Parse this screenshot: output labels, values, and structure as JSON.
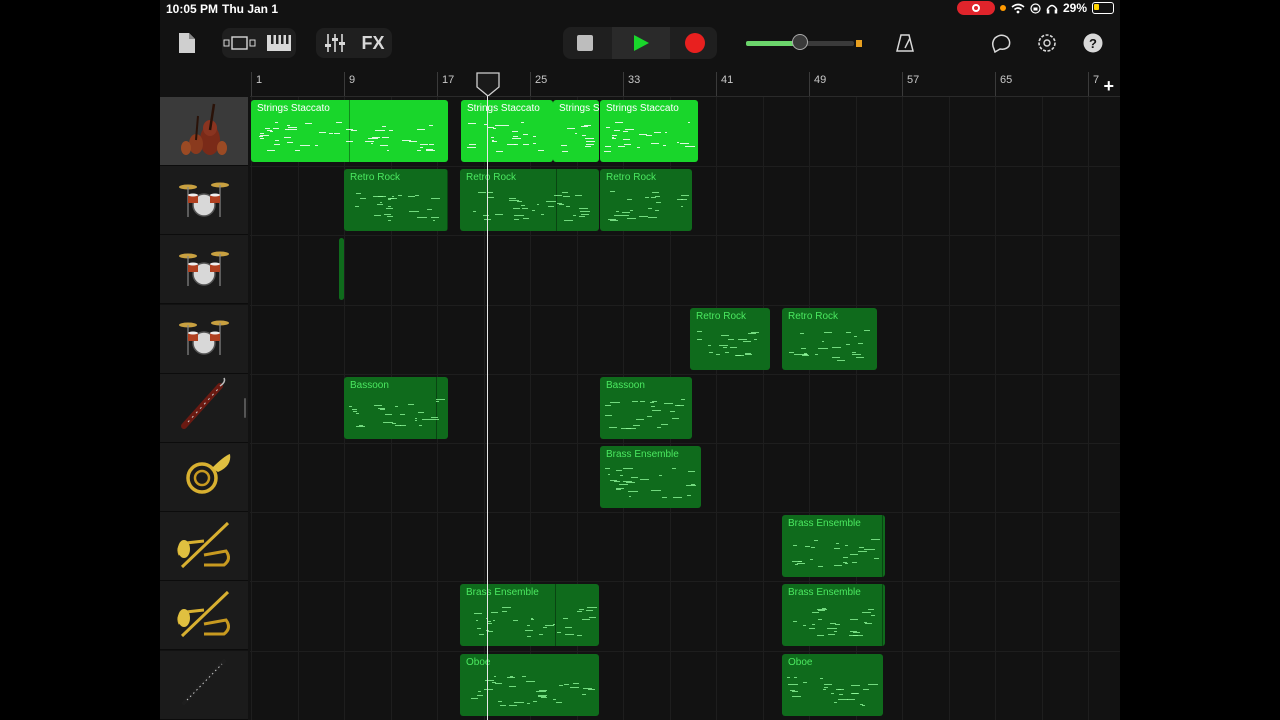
{
  "status": {
    "time": "10:05 PM",
    "date": "Thu Jan 1",
    "battery": "29%"
  },
  "toolbar": {
    "icons": [
      "document-icon",
      "tracks-view-icon",
      "keyboard-icon",
      "mixer-icon"
    ],
    "fx_label": "FX",
    "volume_level": 0.5,
    "colors": {
      "play": "#19d62b",
      "record": "#e8201f",
      "stop": "#bdbdbd"
    }
  },
  "ruler": {
    "labels": [
      "1",
      "9",
      "17",
      "25",
      "33",
      "41",
      "49",
      "57",
      "65",
      "7"
    ]
  },
  "tracks": [
    {
      "name": "strings",
      "icon": "strings-icon",
      "selected": true
    },
    {
      "name": "drums-1",
      "icon": "drum-kit-icon"
    },
    {
      "name": "drums-2",
      "icon": "drum-kit-icon"
    },
    {
      "name": "drums-3",
      "icon": "drum-kit-icon"
    },
    {
      "name": "bassoon",
      "icon": "bassoon-icon"
    },
    {
      "name": "french-horn",
      "icon": "french-horn-icon"
    },
    {
      "name": "brass-1",
      "icon": "brass-icon"
    },
    {
      "name": "brass-2",
      "icon": "brass-icon"
    },
    {
      "name": "oboe",
      "icon": "oboe-icon"
    }
  ],
  "regions": [
    {
      "track": 0,
      "label": "Strings Staccato",
      "style": "bright"
    },
    {
      "track": 0,
      "label": "Strings Staccato",
      "style": "bright"
    },
    {
      "track": 0,
      "label": "Strings Staccato",
      "style": "bright"
    },
    {
      "track": 0,
      "label": "Strings Staccato",
      "style": "bright"
    },
    {
      "track": 1,
      "label": "Retro Rock",
      "style": "dark"
    },
    {
      "track": 1,
      "label": "Retro Rock",
      "style": "dark"
    },
    {
      "track": 1,
      "label": "Retro Rock",
      "style": "dark"
    },
    {
      "track": 2,
      "label": "",
      "style": "dark"
    },
    {
      "track": 3,
      "label": "Retro Rock",
      "style": "dark"
    },
    {
      "track": 3,
      "label": "Retro Rock",
      "style": "dark"
    },
    {
      "track": 4,
      "label": "Bassoon",
      "style": "dark"
    },
    {
      "track": 4,
      "label": "Bassoon",
      "style": "dark"
    },
    {
      "track": 5,
      "label": "Brass Ensemble",
      "style": "dark"
    },
    {
      "track": 6,
      "label": "Brass Ensemble",
      "style": "dark"
    },
    {
      "track": 7,
      "label": "Brass Ensemble",
      "style": "dark"
    },
    {
      "track": 7,
      "label": "Brass Ensemble",
      "style": "dark"
    },
    {
      "track": 8,
      "label": "Oboe",
      "style": "dark"
    },
    {
      "track": 8,
      "label": "Oboe",
      "style": "dark"
    }
  ]
}
